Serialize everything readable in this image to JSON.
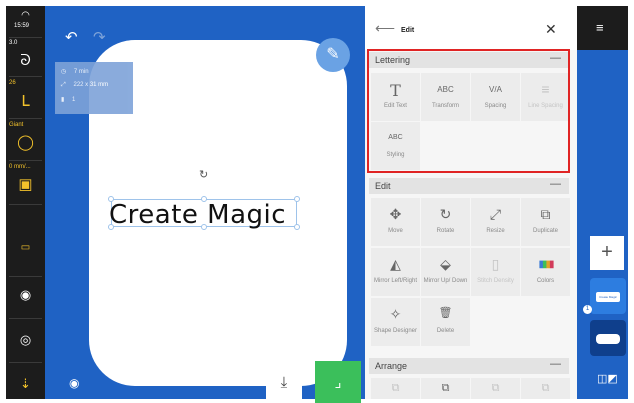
{
  "status": {
    "time": "15:59"
  },
  "left_sidebar": {
    "items": [
      {
        "label": "3.0",
        "icon": "presser-foot-icon"
      },
      {
        "label": "26",
        "icon": "stitch-foot-icon"
      },
      {
        "label": "Giant",
        "icon": "hoop-icon"
      },
      {
        "label": "0 mm/...",
        "icon": "embroidery-unit-icon"
      },
      {
        "label": "",
        "icon": "thread-icon"
      },
      {
        "label": "",
        "icon": "needle-stop-icon"
      },
      {
        "label": "",
        "icon": "camera-icon"
      },
      {
        "label": "",
        "icon": "needle-icon"
      }
    ]
  },
  "canvas": {
    "info": {
      "time": "7 min",
      "size": "222 x 31 mm",
      "count": "1"
    },
    "design_text": "Create Magic"
  },
  "edit_panel": {
    "title": "Edit",
    "sections": [
      {
        "name": "Lettering",
        "tools": [
          {
            "label": "Edit Text",
            "glyph": "T",
            "enabled": true
          },
          {
            "label": "Transform",
            "glyph": "ABC",
            "enabled": true
          },
          {
            "label": "Spacing",
            "glyph": "V/A",
            "enabled": true
          },
          {
            "label": "Line Spacing",
            "glyph": "≡",
            "enabled": false
          },
          {
            "label": "Styling",
            "glyph": "ABC",
            "enabled": true
          }
        ]
      },
      {
        "name": "Edit",
        "tools": [
          {
            "label": "Move",
            "glyph": "✥",
            "enabled": true
          },
          {
            "label": "Rotate",
            "glyph": "↻",
            "enabled": true
          },
          {
            "label": "Resize",
            "glyph": "⤢",
            "enabled": true
          },
          {
            "label": "Duplicate",
            "glyph": "⧉",
            "enabled": true
          },
          {
            "label": "Mirror Left/Right",
            "glyph": "◭",
            "enabled": true
          },
          {
            "label": "Mirror Up/ Down",
            "glyph": "⬙",
            "enabled": true
          },
          {
            "label": "Stitch Density",
            "glyph": "▯",
            "enabled": false
          },
          {
            "label": "Colors",
            "glyph": "▮▮▮",
            "enabled": true
          },
          {
            "label": "Shape Designer",
            "glyph": "✧",
            "enabled": true
          },
          {
            "label": "Delete",
            "glyph": "🗑",
            "enabled": true
          }
        ]
      },
      {
        "name": "Arrange",
        "tools": []
      }
    ]
  },
  "right_rail": {
    "badge": "1",
    "thumb_label": "Create Magic"
  },
  "colors": {
    "accent_blue": "#1f62c4",
    "highlight_red": "#e02424",
    "confirm_green": "#3bbf5b",
    "sidebar_yellow": "#f3c22b"
  }
}
